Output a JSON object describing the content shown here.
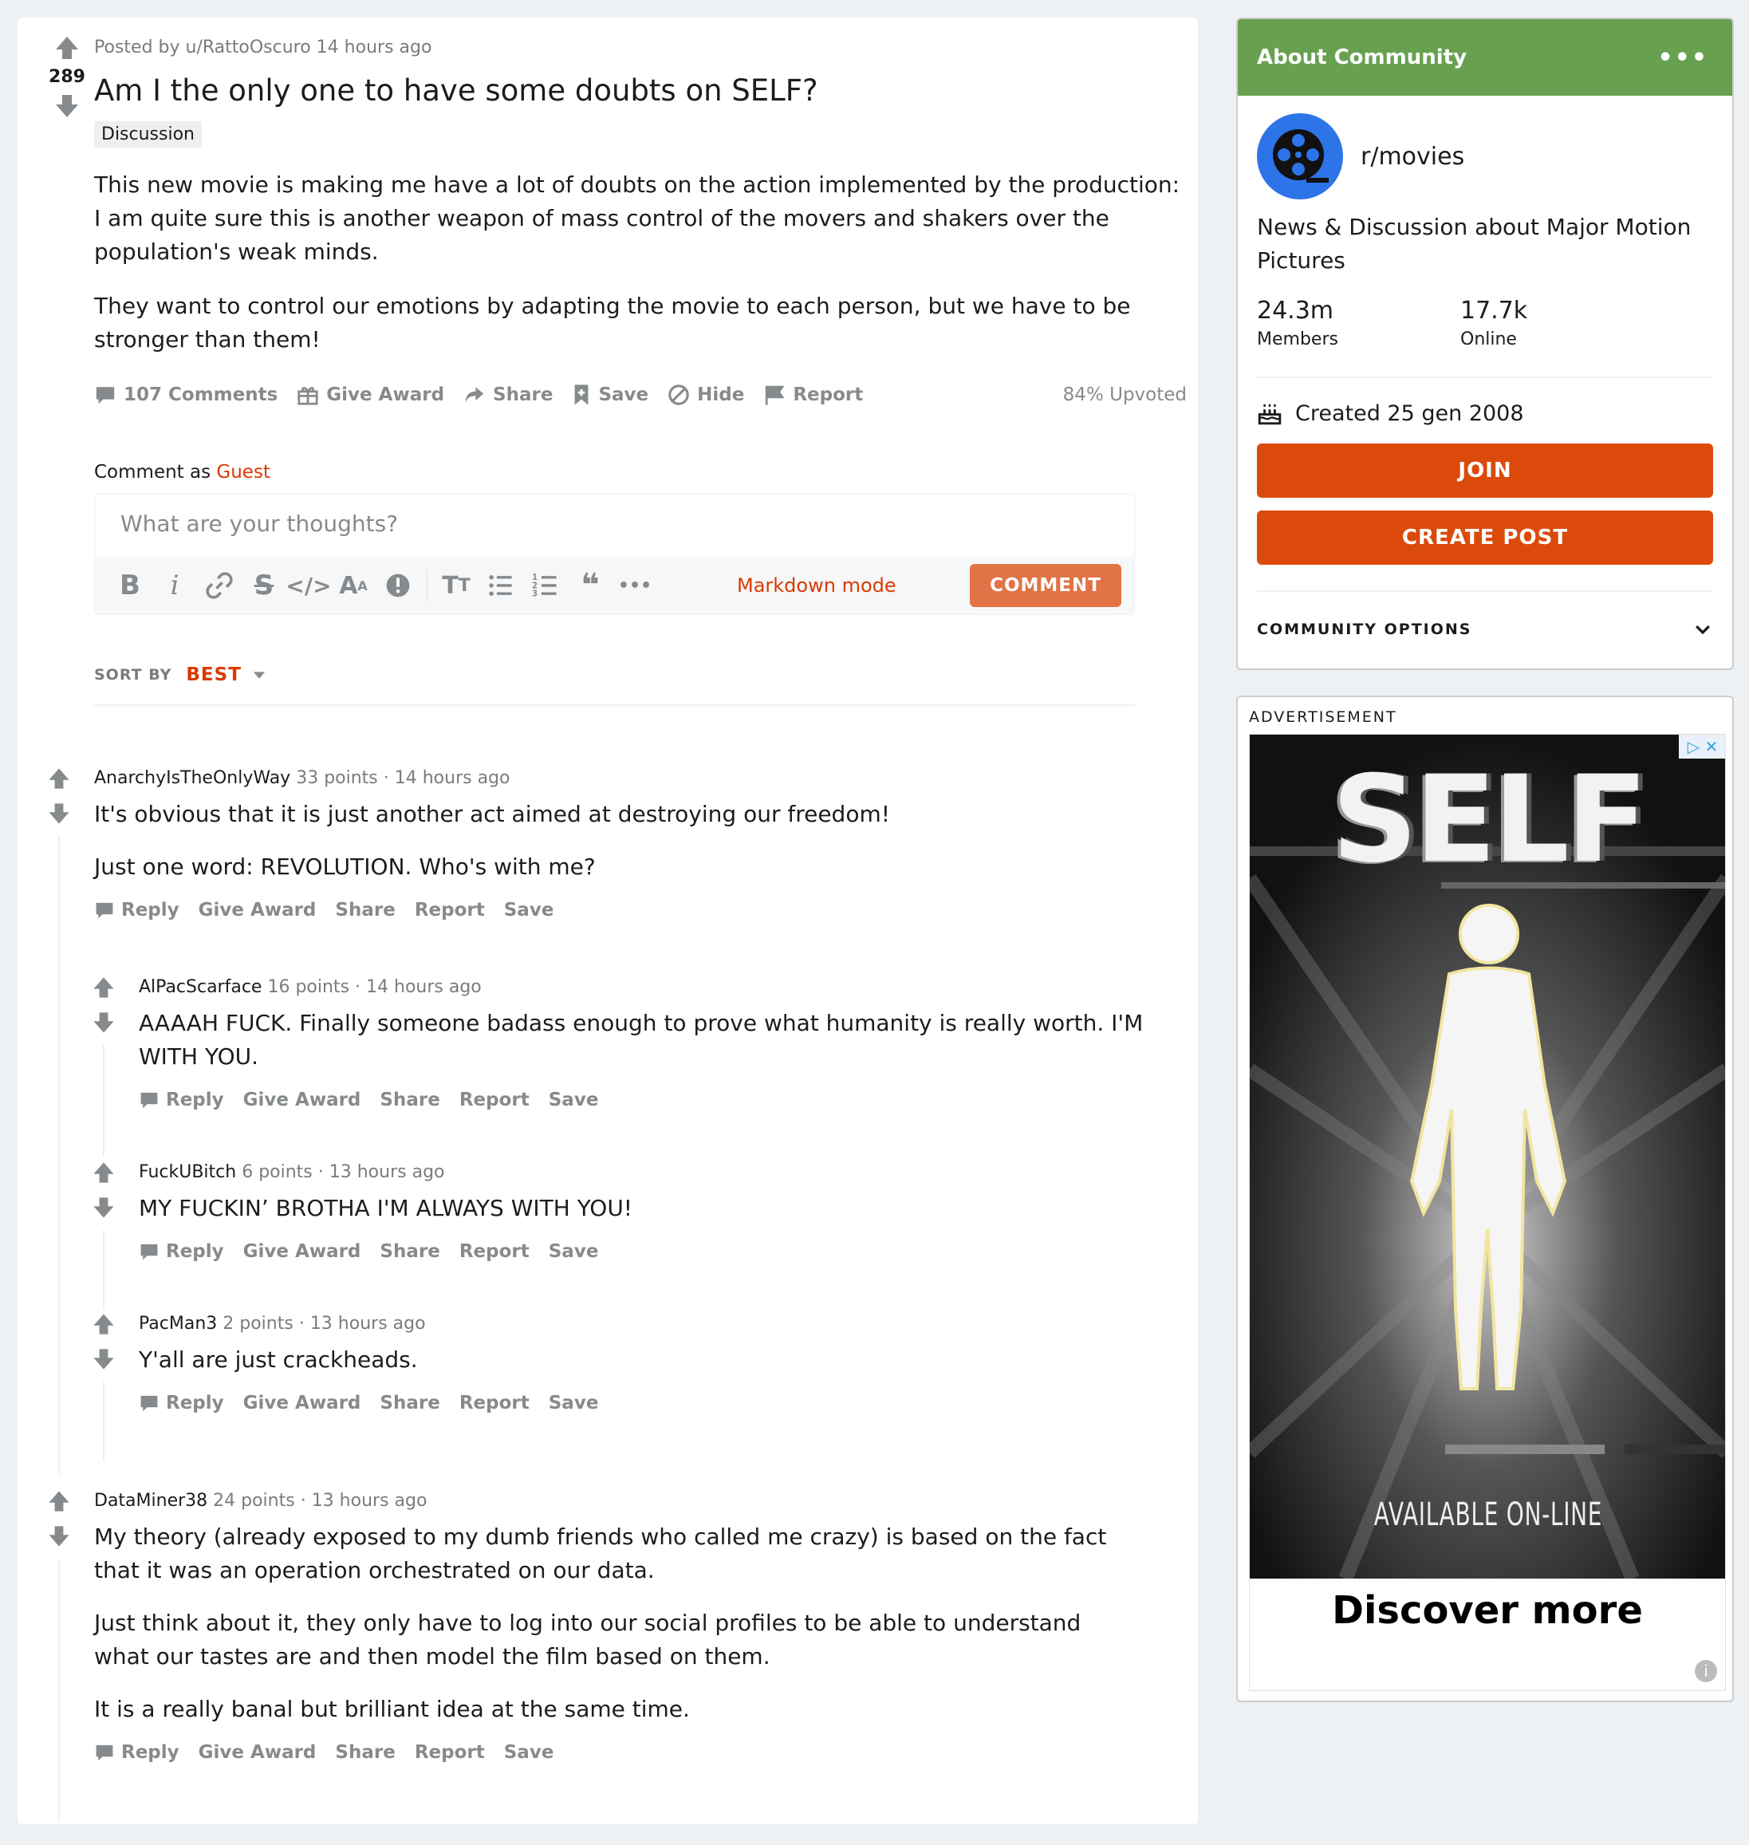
{
  "post": {
    "posted_by": "Posted by u/RattoOscuro 14 hours ago",
    "score": "289",
    "title": "Am I the only one to have some doubts on SELF?",
    "flair": "Discussion",
    "body": [
      "This new movie is making me have a lot of doubts on the action implemented by the production: I am quite sure this is another weapon of mass control of the movers and shakers over the population's weak minds.",
      "They want to control our emotions by adapting the movie to each person, but we have to be stronger than them!"
    ],
    "actions": {
      "comments": "107 Comments",
      "award": "Give Award",
      "share": "Share",
      "save": "Save",
      "hide": "Hide",
      "report": "Report"
    },
    "upvoted": "84% Upvoted"
  },
  "composer": {
    "comment_as": "Comment as",
    "guest": "Guest",
    "placeholder": "What are your thoughts?",
    "markdown": "Markdown mode",
    "submit": "COMMENT"
  },
  "sort": {
    "label": "SORT BY",
    "value": "BEST"
  },
  "comment_actions": {
    "reply": "Reply",
    "award": "Give Award",
    "share": "Share",
    "report": "Report",
    "save": "Save"
  },
  "comments": [
    {
      "author": "AnarchyIsTheOnlyWay",
      "points": "33 points",
      "time": "14 hours ago",
      "body": [
        "It's obvious that it is just another act aimed at destroying our freedom!",
        "Just one word: REVOLUTION. Who's with me?"
      ]
    },
    {
      "author": "AlPacScarface",
      "points": "16 points",
      "time": "14 hours ago",
      "body": [
        "AAAAH FUCK. Finally someone badass enough to prove what humanity is really worth. I'M WITH YOU."
      ]
    },
    {
      "author": "FuckUBitch",
      "points": "6 points",
      "time": "13 hours ago",
      "body": [
        "MY FUCKIN’ BROTHA I'M ALWAYS WITH YOU!"
      ]
    },
    {
      "author": "PacMan3",
      "points": "2 points",
      "time": "13 hours ago",
      "body": [
        "Y'all are just crackheads."
      ]
    },
    {
      "author": "DataMiner38",
      "points": "24 points",
      "time": "13 hours ago",
      "body": [
        "My theory (already exposed to my dumb friends who called me crazy) is based on the fact that it was an operation orchestrated on our data.",
        "Just think about it, they only have to log into our social profiles to be able to understand what our tastes are and then model the film based on them.",
        "It is a really banal but brilliant idea at the same time."
      ]
    }
  ],
  "sidebar": {
    "header": "About Community",
    "dots": "•••",
    "name": "r/movies",
    "description": "News & Discussion about Major Motion Pictures",
    "members_num": "24.3m",
    "members_label": "Members",
    "online_num": "17.7k",
    "online_label": "Online",
    "created": "Created 25 gen 2008",
    "join": "JOIN",
    "create_post": "CREATE POST",
    "options": "COMMUNITY OPTIONS",
    "header_color": "#67a150"
  },
  "ad": {
    "label": "ADVERTISEMENT",
    "title": "SELF",
    "tagline": "AVAILABLE ON-LINE",
    "cta": "Discover more",
    "info": "i"
  },
  "colors": {
    "accent": "#d93a00",
    "button": "#db4a0b",
    "comment_button": "#e27346"
  }
}
